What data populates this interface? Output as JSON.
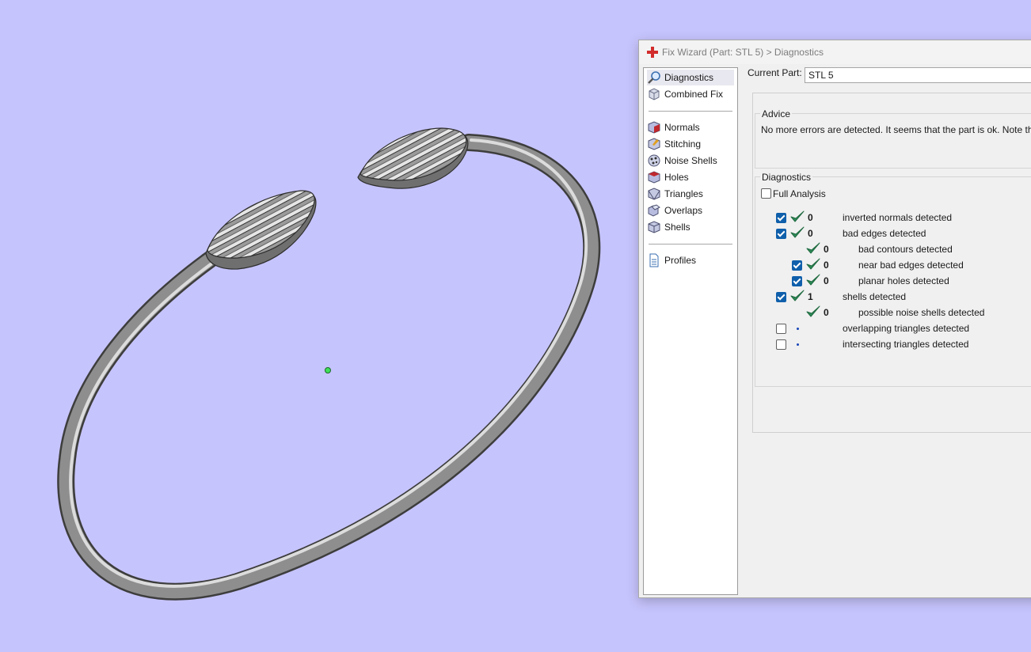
{
  "window": {
    "title": "Fix Wizard (Part: STL 5) > Diagnostics"
  },
  "nav": {
    "top_items": [
      {
        "label": "Diagnostics",
        "icon": "magnifier-icon",
        "active": true
      },
      {
        "label": "Combined Fix",
        "icon": "cube-icon"
      }
    ],
    "tool_items": [
      {
        "label": "Normals",
        "icon": "normals-cube-icon"
      },
      {
        "label": "Stitching",
        "icon": "stitching-cube-icon"
      },
      {
        "label": "Noise Shells",
        "icon": "noise-shells-icon"
      },
      {
        "label": "Holes",
        "icon": "holes-cube-icon"
      },
      {
        "label": "Triangles",
        "icon": "triangles-cube-icon"
      },
      {
        "label": "Overlaps",
        "icon": "overlaps-icon"
      },
      {
        "label": "Shells",
        "icon": "shells-icon"
      }
    ],
    "bottom_items": [
      {
        "label": "Profiles",
        "icon": "document-icon"
      }
    ]
  },
  "current_part": {
    "label": "Current Part:",
    "value": "STL 5"
  },
  "advice": {
    "title": "Advice",
    "text": "No more errors are detected. It seems that the part is ok. Note that no"
  },
  "diagnostics": {
    "title": "Diagnostics",
    "full_analysis": {
      "label": "Full Analysis",
      "checked": false
    },
    "rows": [
      {
        "indent": 0,
        "has_checkbox": true,
        "checked": true,
        "status": "ok",
        "count": "0",
        "label": "inverted normals detected"
      },
      {
        "indent": 0,
        "has_checkbox": true,
        "checked": true,
        "status": "ok",
        "count": "0",
        "label": "bad edges detected"
      },
      {
        "indent": 1,
        "has_checkbox": false,
        "checked": false,
        "status": "ok",
        "count": "0",
        "label": "bad contours detected"
      },
      {
        "indent": 1,
        "has_checkbox": true,
        "checked": true,
        "status": "ok",
        "count": "0",
        "label": "near bad edges detected"
      },
      {
        "indent": 1,
        "has_checkbox": true,
        "checked": true,
        "status": "ok",
        "count": "0",
        "label": "planar holes detected"
      },
      {
        "indent": 0,
        "has_checkbox": true,
        "checked": true,
        "status": "ok",
        "count": "1",
        "label": "shells detected"
      },
      {
        "indent": 1,
        "has_checkbox": false,
        "checked": false,
        "status": "ok",
        "count": "0",
        "label": "possible noise shells detected"
      },
      {
        "indent": 0,
        "has_checkbox": true,
        "checked": false,
        "status": "pending",
        "count": "",
        "label": "overlapping triangles detected"
      },
      {
        "indent": 0,
        "has_checkbox": true,
        "checked": false,
        "status": "pending",
        "count": "",
        "label": "intersecting triangles detected"
      }
    ]
  },
  "colors": {
    "viewport_bg": "#c6c4fc",
    "checkmark": "#2e8b57",
    "checkbox_checked": "#0f5fab",
    "title_icon": "#d22b2b",
    "model_gray": "#8e8e8e"
  }
}
